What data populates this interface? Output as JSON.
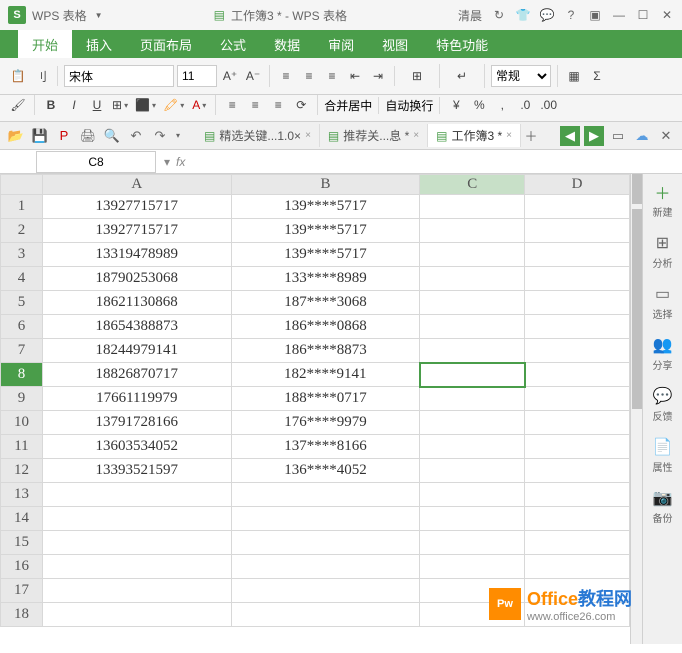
{
  "titlebar": {
    "app_logo": "S",
    "app_name": "WPS 表格",
    "doc_title": "工作簿3 * - WPS 表格",
    "user_name": "清晨"
  },
  "menu": {
    "items": [
      "开始",
      "插入",
      "页面布局",
      "公式",
      "数据",
      "审阅",
      "视图",
      "特色功能"
    ]
  },
  "toolbar": {
    "paste_label": "刂",
    "font_name": "宋体",
    "font_size": "11",
    "merge_label": "合并居中",
    "wrap_label": "自动换行",
    "format_label": "常规"
  },
  "doc_tabs": [
    {
      "label": "精选关键...1.0×"
    },
    {
      "label": "推荐关...息 *"
    },
    {
      "label": "工作簿3 *"
    }
  ],
  "namebox": {
    "cell_ref": "C8",
    "fx": "fx"
  },
  "sheet": {
    "columns": [
      "A",
      "B",
      "C",
      "D"
    ],
    "row_count": 18,
    "selected_cell": "C8",
    "data": {
      "A": [
        "13927715717",
        "13927715717",
        "13319478989",
        "18790253068",
        "18621130868",
        "18654388873",
        "18244979141",
        "18826870717",
        "17661119979",
        "13791728166",
        "13603534052",
        "13393521597"
      ],
      "B": [
        "139****5717",
        "139****5717",
        "139****5717",
        "133****8989",
        "187****3068",
        "186****0868",
        "186****8873",
        "182****9141",
        "188****0717",
        "176****9979",
        "137****8166",
        "136****4052"
      ]
    }
  },
  "sidebar": {
    "items": [
      {
        "icon": "＋",
        "label": "新建"
      },
      {
        "icon": "⊞",
        "label": "分析"
      },
      {
        "icon": "▭",
        "label": "选择"
      },
      {
        "icon": "👥",
        "label": "分享"
      },
      {
        "icon": "💬",
        "label": "反馈"
      },
      {
        "icon": "📄",
        "label": "属性"
      },
      {
        "icon": "📷",
        "label": "备份"
      }
    ]
  },
  "watermark": {
    "logo_text": "Pw",
    "title_a": "Office",
    "title_b": "教程网",
    "url": "www.office26.com"
  }
}
